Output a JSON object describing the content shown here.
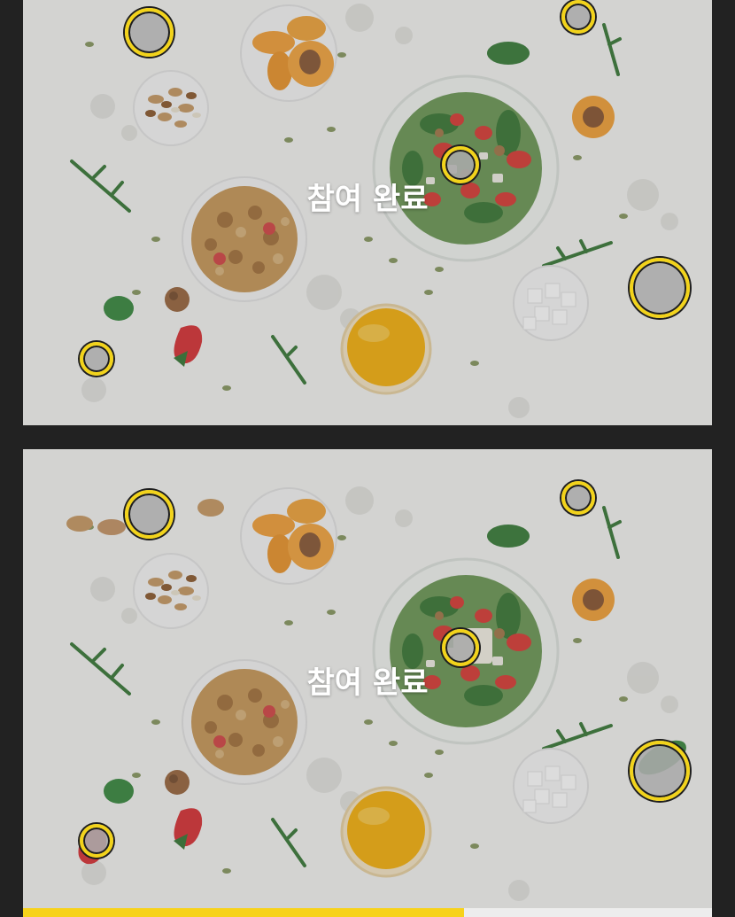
{
  "status": {
    "done_label": "참여 완료"
  },
  "progress": {
    "fraction": 0.64
  },
  "colors": {
    "background": "#222222",
    "marker": "#f2d31b",
    "progress": "#f7d21a"
  }
}
